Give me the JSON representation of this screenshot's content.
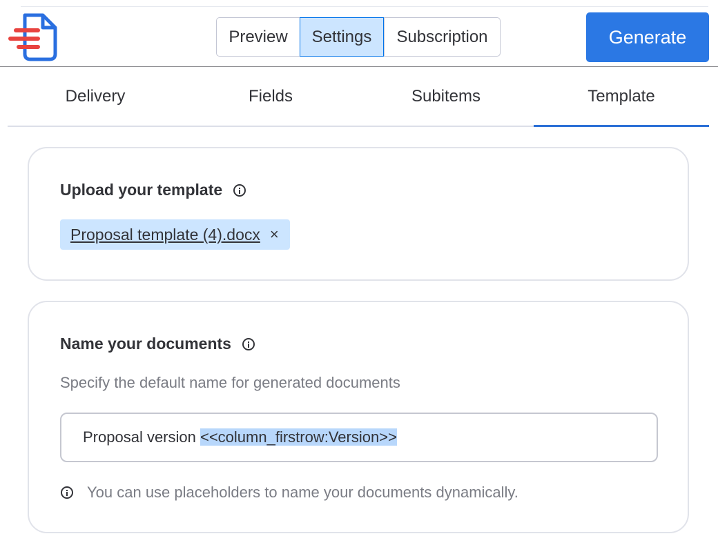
{
  "header": {
    "segments": [
      "Preview",
      "Settings",
      "Subscription"
    ],
    "active_segment": "Settings",
    "generate_label": "Generate"
  },
  "tabs": [
    {
      "label": "Delivery"
    },
    {
      "label": "Fields"
    },
    {
      "label": "Subitems"
    },
    {
      "label": "Template"
    }
  ],
  "active_tab": "Template",
  "upload_section": {
    "title": "Upload your template",
    "file_name": "Proposal template (4).docx",
    "remove_glyph": "×"
  },
  "naming_section": {
    "title": "Name your documents",
    "description": "Specify the default name for generated documents",
    "input_prefix": "Proposal version ",
    "input_placeholder_token": "<<column_firstrow:Version>>",
    "hint": "You can use placeholders to name your documents dynamically."
  },
  "colors": {
    "accent": "#2b78e4",
    "selected_bg": "#cce5ff",
    "logo_red": "#e8433f",
    "logo_blue": "#2a6fe0"
  },
  "icons": [
    "document-logo-icon",
    "info-icon",
    "close-icon"
  ]
}
